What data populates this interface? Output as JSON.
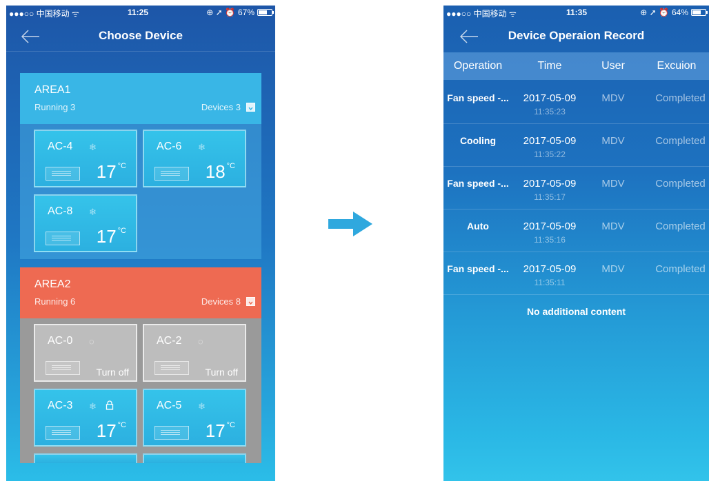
{
  "left_screen": {
    "status": {
      "carrier": "●●●○○ 中国移动 ᯤ",
      "time": "11:25",
      "indicators": "⊕ ➚ ⏰",
      "battery": "67%",
      "battery_level": 0.67
    },
    "title": "Choose Device",
    "areas": [
      {
        "name": "AREA1",
        "running": "Running 3",
        "devices": "Devices 3",
        "color": "#39b6e6",
        "tiles": [
          {
            "name": "AC-4",
            "temp": "17",
            "unit": "°C",
            "state": "on"
          },
          {
            "name": "AC-6",
            "temp": "18",
            "unit": "°C",
            "state": "on"
          },
          {
            "name": "AC-8",
            "temp": "17",
            "unit": "°C",
            "state": "on"
          }
        ]
      },
      {
        "name": "AREA2",
        "running": "Running 6",
        "devices": "Devices 8",
        "color": "#ee6a52",
        "tiles": [
          {
            "name": "AC-0",
            "status": "Turn off",
            "state": "off"
          },
          {
            "name": "AC-2",
            "status": "Turn off",
            "state": "off"
          },
          {
            "name": "AC-3",
            "temp": "17",
            "unit": "°C",
            "state": "on",
            "locked": true
          },
          {
            "name": "AC-5",
            "temp": "17",
            "unit": "°C",
            "state": "on"
          }
        ]
      }
    ]
  },
  "right_screen": {
    "status": {
      "carrier": "●●●○○ 中国移动 ᯤ",
      "time": "11:35",
      "indicators": "⊕ ➚ ⏰",
      "battery": "64%",
      "battery_level": 0.64
    },
    "title": "Device Operaion Record",
    "columns": [
      "Operation",
      "Time",
      "User",
      "Excuion"
    ],
    "records": [
      {
        "operation": "Fan speed -...",
        "date": "2017-05-09",
        "time": "11:35:23",
        "user": "MDV",
        "execution": "Completed"
      },
      {
        "operation": "Cooling",
        "date": "2017-05-09",
        "time": "11:35:22",
        "user": "MDV",
        "execution": "Completed"
      },
      {
        "operation": "Fan speed -...",
        "date": "2017-05-09",
        "time": "11:35:17",
        "user": "MDV",
        "execution": "Completed"
      },
      {
        "operation": "Auto",
        "date": "2017-05-09",
        "time": "11:35:16",
        "user": "MDV",
        "execution": "Completed"
      },
      {
        "operation": "Fan speed -...",
        "date": "2017-05-09",
        "time": "11:35:11",
        "user": "MDV",
        "execution": "Completed"
      }
    ],
    "footer": "No additional content"
  },
  "colors": {
    "arrow": "#2fa8de",
    "area1": "#39b6e6",
    "area2": "#ee6a52"
  }
}
